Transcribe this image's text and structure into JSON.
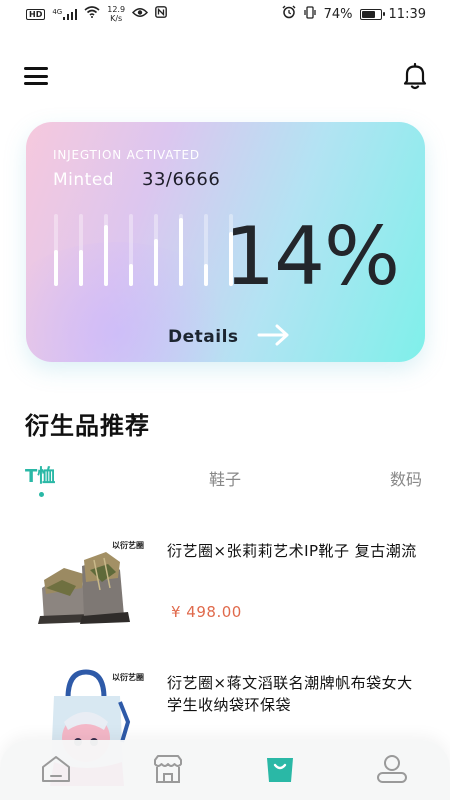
{
  "status_bar": {
    "hd": "HD",
    "network": "4G",
    "speed_value": "12.9",
    "speed_unit": "K/s",
    "battery_text": "74%",
    "battery_level": 0.74,
    "time": "11:39"
  },
  "header": {
    "menu_icon": "hamburger-menu-icon",
    "notification_icon": "bell-icon"
  },
  "card": {
    "label": "INJEGTION ACTIVATED",
    "minted_label": "Minted",
    "minted_value": "33/6666",
    "percent": "14%",
    "details_label": "Details",
    "bar_levels": [
      0.5,
      0.5,
      0.85,
      0.3,
      0.65,
      0.95,
      0.3,
      0.75
    ],
    "colors": {
      "gradient_start": "#f6c9dd",
      "gradient_mid": "#b3e3f3",
      "gradient_end": "#7ff0ea"
    }
  },
  "section": {
    "title": "衍生品推荐",
    "tabs": [
      {
        "label": "T恤",
        "active": true
      },
      {
        "label": "鞋子",
        "active": false
      },
      {
        "label": "数码",
        "active": false
      }
    ],
    "accent_color": "#2ab8a6"
  },
  "products": [
    {
      "brand": "以衍艺圈",
      "title": "衍艺圈×张莉莉艺术IP靴子 复古潮流",
      "price": "¥ 498.00",
      "image": "boots"
    },
    {
      "brand": "以衍艺圈",
      "title": "衍艺圈×蒋文滔联名潮牌帆布袋女大学生收纳袋环保袋",
      "price": "",
      "image": "tote-bag"
    }
  ],
  "bottom_nav": {
    "items": [
      {
        "icon": "home-icon",
        "active": false
      },
      {
        "icon": "store-icon",
        "active": false
      },
      {
        "icon": "shopping-bag-icon",
        "active": true
      },
      {
        "icon": "profile-icon",
        "active": false
      }
    ],
    "active_color": "#2ab8a6"
  }
}
